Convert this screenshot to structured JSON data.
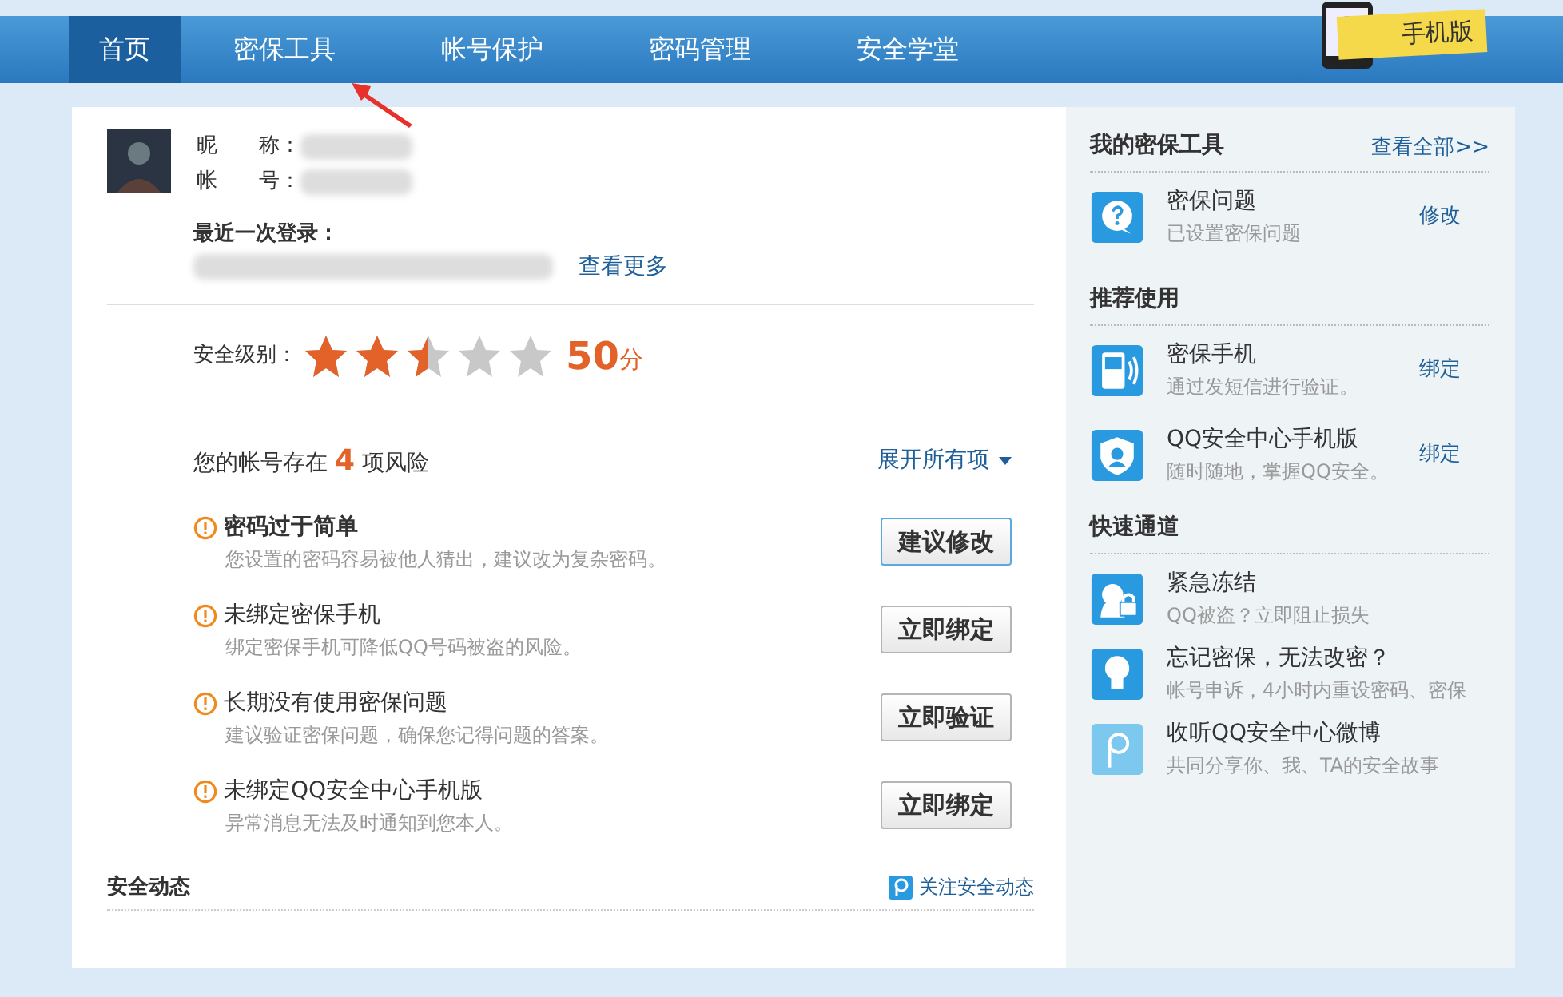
{
  "nav": {
    "items": [
      {
        "label": "首页",
        "selected": true
      },
      {
        "label": "密保工具",
        "selected": false
      },
      {
        "label": "帐号保护",
        "selected": false
      },
      {
        "label": "密码管理",
        "selected": false
      },
      {
        "label": "安全学堂",
        "selected": false
      }
    ],
    "badge": "手机版"
  },
  "profile": {
    "fields": [
      {
        "label": "昵　　称："
      },
      {
        "label": "帐　　号："
      }
    ],
    "last_login_label": "最近一次登录：",
    "more_link": "查看更多"
  },
  "security": {
    "label": "安全级别：",
    "stars": 2.5,
    "score": "50",
    "unit": "分"
  },
  "risks": {
    "prefix": "您的帐号存在",
    "count": "4",
    "suffix": "项风险",
    "expand": "展开所有项",
    "items": [
      {
        "title": "密码过于简单",
        "desc": "您设置的密码容易被他人猜出，建议改为复杂密码。",
        "button": "建议修改",
        "highlight": true
      },
      {
        "title": "未绑定密保手机",
        "desc": "绑定密保手机可降低QQ号码被盗的风险。",
        "button": "立即绑定",
        "highlight": false
      },
      {
        "title": "长期没有使用密保问题",
        "desc": "建议验证密保问题，确保您记得问题的答案。",
        "button": "立即验证",
        "highlight": false
      },
      {
        "title": "未绑定QQ安全中心手机版",
        "desc": "异常消息无法及时通知到您本人。",
        "button": "立即绑定",
        "highlight": false
      }
    ]
  },
  "activity": {
    "title": "安全动态",
    "follow": "关注安全动态"
  },
  "sidebar": [
    {
      "title": "我的密保工具",
      "link": "查看全部>>",
      "items": [
        {
          "kind": "question",
          "name": "密保问题",
          "desc": "已设置密保问题",
          "action": "修改"
        }
      ]
    },
    {
      "title": "推荐使用",
      "items": [
        {
          "kind": "phone",
          "name": "密保手机",
          "desc": "通过发短信进行验证。",
          "action": "绑定"
        },
        {
          "kind": "shield",
          "name": "QQ安全中心手机版",
          "desc": "随时随地，掌握QQ安全。",
          "action": "绑定"
        }
      ]
    },
    {
      "title": "快速通道",
      "items": [
        {
          "kind": "lock",
          "name": "紧急冻结",
          "desc": "QQ被盗？立即阻止损失"
        },
        {
          "kind": "bulb",
          "name": "忘记密保，无法改密？",
          "desc": "帐号申诉，4小时内重设密码、密保"
        },
        {
          "kind": "weibo",
          "name": "收听QQ安全中心微博",
          "desc": "共同分享你、我、TA的安全故事"
        }
      ]
    }
  ]
}
